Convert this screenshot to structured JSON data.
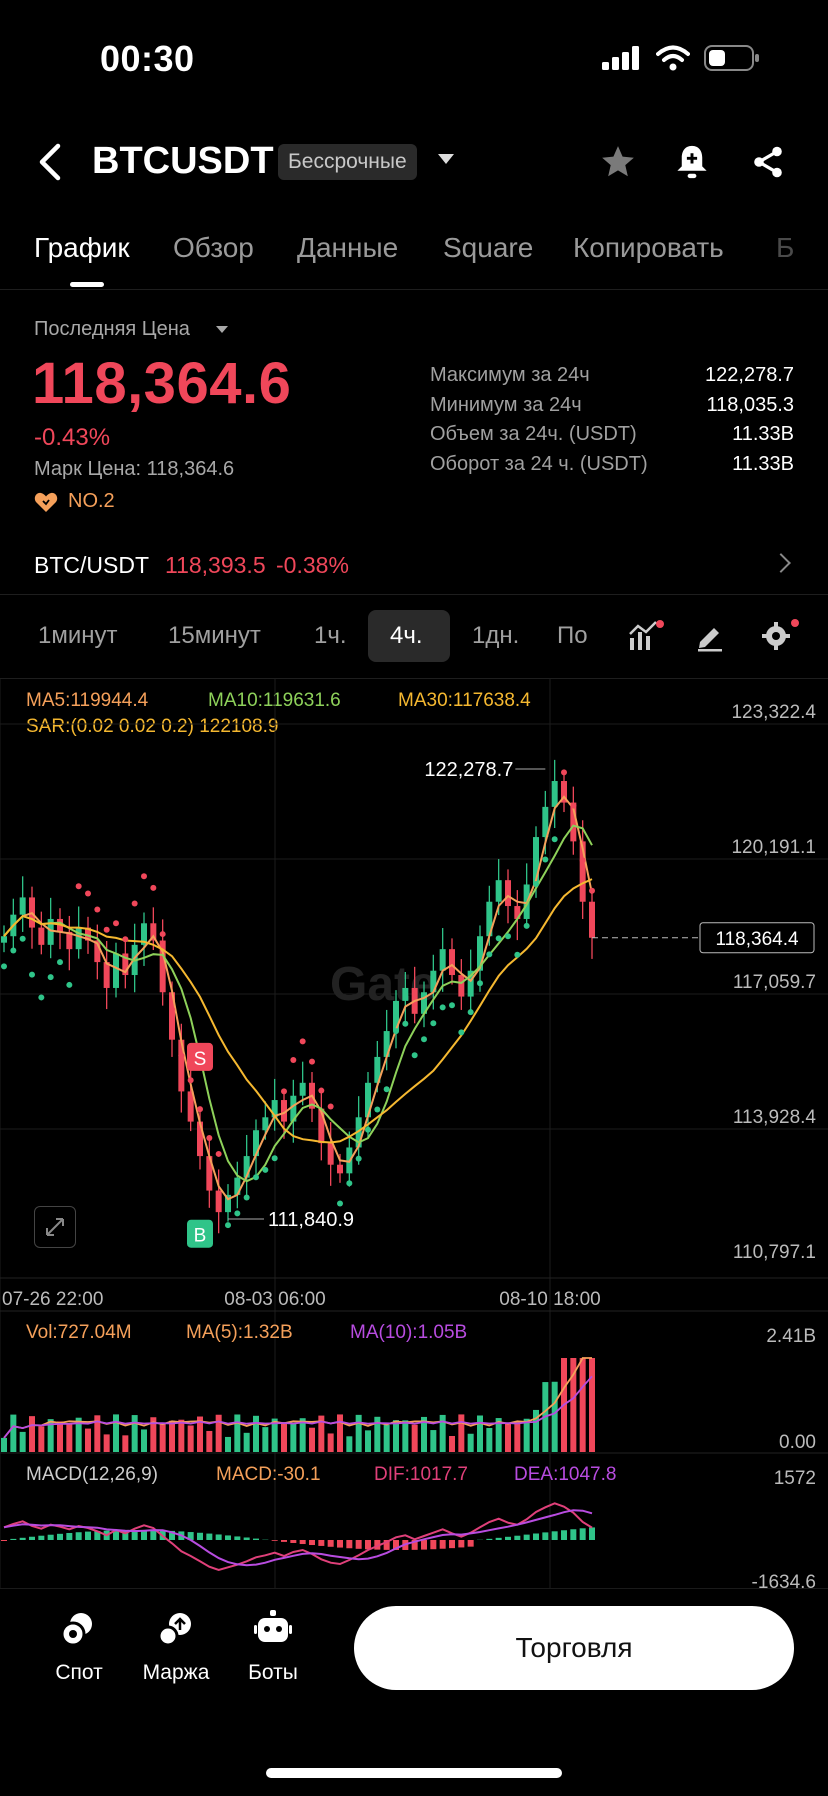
{
  "status": {
    "time": "00:30"
  },
  "header": {
    "title": "BTCUSDT",
    "badge": "Бессрочные"
  },
  "tabs": [
    "График",
    "Обзор",
    "Данные",
    "Square",
    "Копировать",
    "Б"
  ],
  "price": {
    "last_label": "Последняя Цена",
    "last": "118,364.6",
    "change": "-0.43%",
    "mark": "Марк Цена: 118,364.6",
    "rank": "NO.2"
  },
  "stats": [
    {
      "k": "Максимум за 24ч",
      "v": "122,278.7"
    },
    {
      "k": "Минимум за 24ч",
      "v": "118,035.3"
    },
    {
      "k": "Объем за 24ч. (USDT)",
      "v": "11.33B"
    },
    {
      "k": "Оборот за 24 ч. (USDT)",
      "v": "11.33B"
    }
  ],
  "spot_pair": {
    "name": "BTC/USDT",
    "price": "118,393.5",
    "change": "-0.38%"
  },
  "timeframes": [
    "1минут",
    "15минут",
    "1ч.",
    "4ч.",
    "1дн.",
    "По"
  ],
  "indicators": {
    "ma5": "MA5:119944.4",
    "ma10": "MA10:119631.6",
    "ma30": "MA30:117638.4",
    "sar": "SAR:(0.02 0.02 0.2) 122108.9",
    "vol": "Vol:727.04M",
    "vol_ma5": "MA(5):1.32B",
    "vol_ma10": "MA(10):1.05B",
    "macd_title": "MACD(12,26,9)",
    "macd": "MACD:-30.1",
    "dif": "DIF:1017.7",
    "dea": "DEA:1047.8"
  },
  "chart_data": {
    "type": "candlestick",
    "price_axis": [
      "123,322.4",
      "120,191.1",
      "117,059.7",
      "113,928.4",
      "110,797.1"
    ],
    "time_axis": [
      "07-26 22:00",
      "08-03 06:00",
      "08-10 18:00"
    ],
    "high_label": "122,278.7",
    "low_label": "111,840.9",
    "current_label": "118,364.4",
    "watermark": "Gate",
    "markers": [
      "S",
      "B"
    ],
    "volume_axis": [
      "2.41B",
      "0.00"
    ],
    "macd_axis": [
      "1572",
      "-1634.6"
    ],
    "close_path": [
      118400,
      118900,
      119300,
      118600,
      118200,
      118800,
      118500,
      118100,
      118600,
      118300,
      117800,
      117200,
      118000,
      117500,
      118200,
      118700,
      118300,
      117100,
      116000,
      114800,
      114100,
      113300,
      112500,
      112000,
      112400,
      112800,
      113300,
      113900,
      114200,
      114600,
      114100,
      114700,
      115000,
      114400,
      113600,
      113100,
      112900,
      113500,
      114200,
      115000,
      115600,
      116200,
      116900,
      117200,
      116600,
      117100,
      117600,
      118100,
      117500,
      117000,
      117600,
      118400,
      119200,
      119700,
      119100,
      118800,
      119600,
      120700,
      121400,
      122000,
      121500,
      120600,
      119200,
      118364
    ]
  },
  "bottom_nav": [
    "Спот",
    "Маржа",
    "Боты"
  ],
  "trade_button": "Торговля",
  "colors": {
    "up": "#2fc489",
    "down": "#f0475a",
    "ma5": "#f5a05a",
    "ma10": "#8ed15a",
    "ma30": "#f5b830",
    "purple": "#b84ce0"
  }
}
